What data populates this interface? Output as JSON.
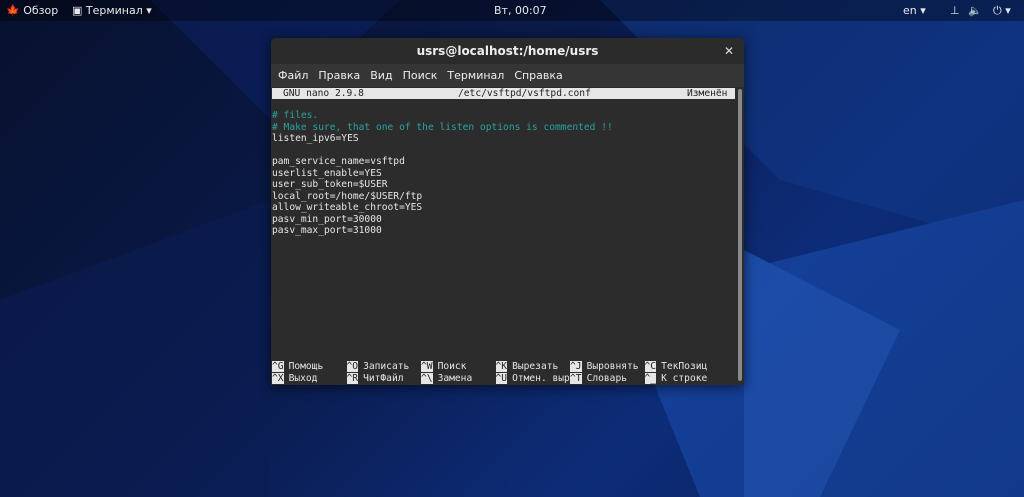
{
  "topbar": {
    "overview": "Обзор",
    "app": "Терминал ▾",
    "clock": "Вт, 00:07",
    "lang": "en ▾",
    "power": "⏻ ▾"
  },
  "window": {
    "title": "usrs@localhost:/home/usrs",
    "close": "✕",
    "menu": [
      "Файл",
      "Правка",
      "Вид",
      "Поиск",
      "Терминал",
      "Справка"
    ]
  },
  "nano": {
    "version": "GNU nano 2.9.8",
    "file": "/etc/vsftpd/vsftpd.conf",
    "state": "Изменён",
    "lines": [
      {
        "text": "# files.",
        "comment": true
      },
      {
        "text": "# Make sure, that one of the listen options is commented !!",
        "comment": true
      },
      {
        "text": "listen_ipv6=YES"
      },
      {
        "text": ""
      },
      {
        "text": "pam_service_name=vsftpd"
      },
      {
        "text": "userlist_enable=YES"
      },
      {
        "text": "user_sub_token=$USER"
      },
      {
        "text": "local_root=/home/$USER/ftp"
      },
      {
        "text": "allow_writeable_chroot=YES"
      },
      {
        "text": "pasv_min_port=30000"
      },
      {
        "text": "pasv_max_port=31000"
      }
    ],
    "shortcuts": [
      [
        {
          "key": "^G",
          "label": "Помощь"
        },
        {
          "key": "^O",
          "label": "Записать"
        },
        {
          "key": "^W",
          "label": "Поиск"
        },
        {
          "key": "^K",
          "label": "Вырезать"
        },
        {
          "key": "^J",
          "label": "Выровнять"
        },
        {
          "key": "^C",
          "label": "ТекПозиц"
        }
      ],
      [
        {
          "key": "^X",
          "label": "Выход"
        },
        {
          "key": "^R",
          "label": "ЧитФайл"
        },
        {
          "key": "^\\",
          "label": "Замена"
        },
        {
          "key": "^U",
          "label": "Отмен. выре"
        },
        {
          "key": "^T",
          "label": "Словарь"
        },
        {
          "key": "^_",
          "label": "К строке"
        }
      ]
    ]
  }
}
